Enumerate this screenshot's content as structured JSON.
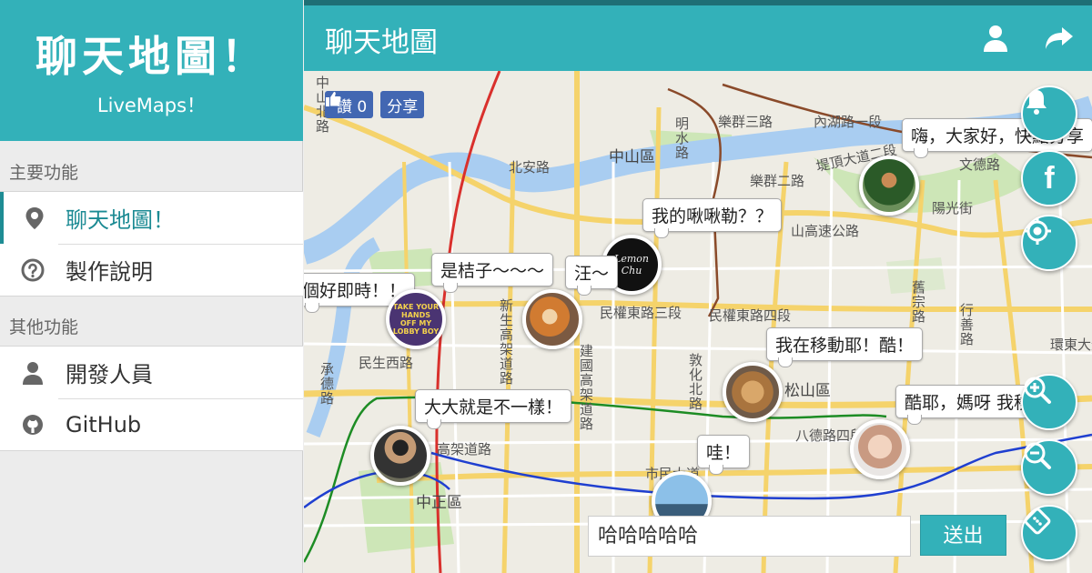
{
  "sidebar": {
    "brand_title": "聊天地圖！",
    "brand_subtitle": "LiveMaps！",
    "sections": [
      {
        "label": "主要功能",
        "items": [
          {
            "icon": "map-pin-icon",
            "label": "聊天地圖！",
            "active": true
          },
          {
            "icon": "help-circle-icon",
            "label": "製作說明",
            "active": false
          }
        ]
      },
      {
        "label": "其他功能",
        "items": [
          {
            "icon": "user-icon",
            "label": "開發人員",
            "active": false
          },
          {
            "icon": "github-icon",
            "label": "GitHub",
            "active": false
          }
        ]
      }
    ]
  },
  "header": {
    "title": "聊天地圖",
    "icons": [
      "user-icon",
      "share-arrow-icon"
    ]
  },
  "fb": {
    "like_label": "讚 0",
    "share_label": "分享"
  },
  "map": {
    "labels": [
      "中山區",
      "北安路",
      "樂群三路",
      "樂群二路",
      "堤頂大道二段",
      "明水路",
      "內湖路一段",
      "陽光街",
      "文德路",
      "山高速公路",
      "民權東路三段",
      "民權東路四段",
      "松山區",
      "八德路四段",
      "市民大道",
      "中正區",
      "高架道路",
      "民生西路",
      "建國高架道路",
      "新生高架道路",
      "敦化北路",
      "環東大道",
      "行善路",
      "舊宗路",
      "中山北路",
      "承德路"
    ]
  },
  "messages": [
    {
      "text": "嗨，大家好，快點分享",
      "avatar": "man-outdoors-photo"
    },
    {
      "text": "我的啾啾勒？？",
      "avatar": "black-signature-logo"
    },
    {
      "text": "是桔子～～～",
      "avatar": "shiba-dog-photo"
    },
    {
      "text": "汪～",
      "avatar": "black-signature-logo"
    },
    {
      "text": "個好即時！！",
      "avatar": "lobby-boy-badge"
    },
    {
      "text": "我在移動耶！酷！",
      "avatar": "cat-photo"
    },
    {
      "text": "大大就是不一樣！",
      "avatar": "man-with-hat-photo"
    },
    {
      "text": "哇！",
      "avatar": "landscape-photo"
    },
    {
      "text": "酷耶，媽呀 我移～",
      "avatar": "child-photo"
    }
  ],
  "lobby_badge": "TAKE YOUR HANDS OFF MY LOBBY BOY",
  "signature": "Lemon Chu",
  "fabs": [
    "bell-icon",
    "facebook-icon",
    "locate-icon",
    "zoom-in-icon",
    "zoom-out-icon",
    "map-style-icon"
  ],
  "chat": {
    "input_value": "哈哈哈哈哈",
    "send_label": "送出"
  },
  "colors": {
    "accent": "#33b1b9",
    "accent_dark": "#1e6f75",
    "fb_blue": "#4267b2"
  }
}
